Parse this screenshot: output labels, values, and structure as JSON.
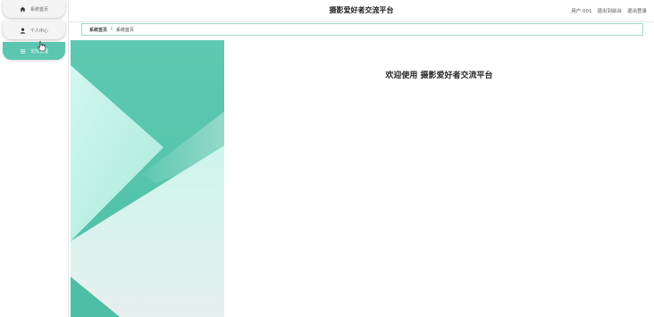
{
  "sidebar": {
    "items": [
      {
        "label": "系统首页",
        "icon": "home-icon"
      },
      {
        "label": "个人中心",
        "icon": "user-icon"
      },
      {
        "label": "论坛管理",
        "icon": "list-icon"
      }
    ]
  },
  "header": {
    "title": "摄影爱好者交流平台",
    "user": "用户 001",
    "back_label": "退出到前台",
    "logout_label": "退出登录"
  },
  "breadcrumb": {
    "home": "系统首页",
    "separator": "I",
    "current": "系统首页"
  },
  "main": {
    "welcome": "欢迎使用 摄影爱好者交流平台"
  },
  "colors": {
    "accent": "#5cc6b0",
    "accent_light": "#c7f3e9",
    "border": "#9fd9cc"
  }
}
